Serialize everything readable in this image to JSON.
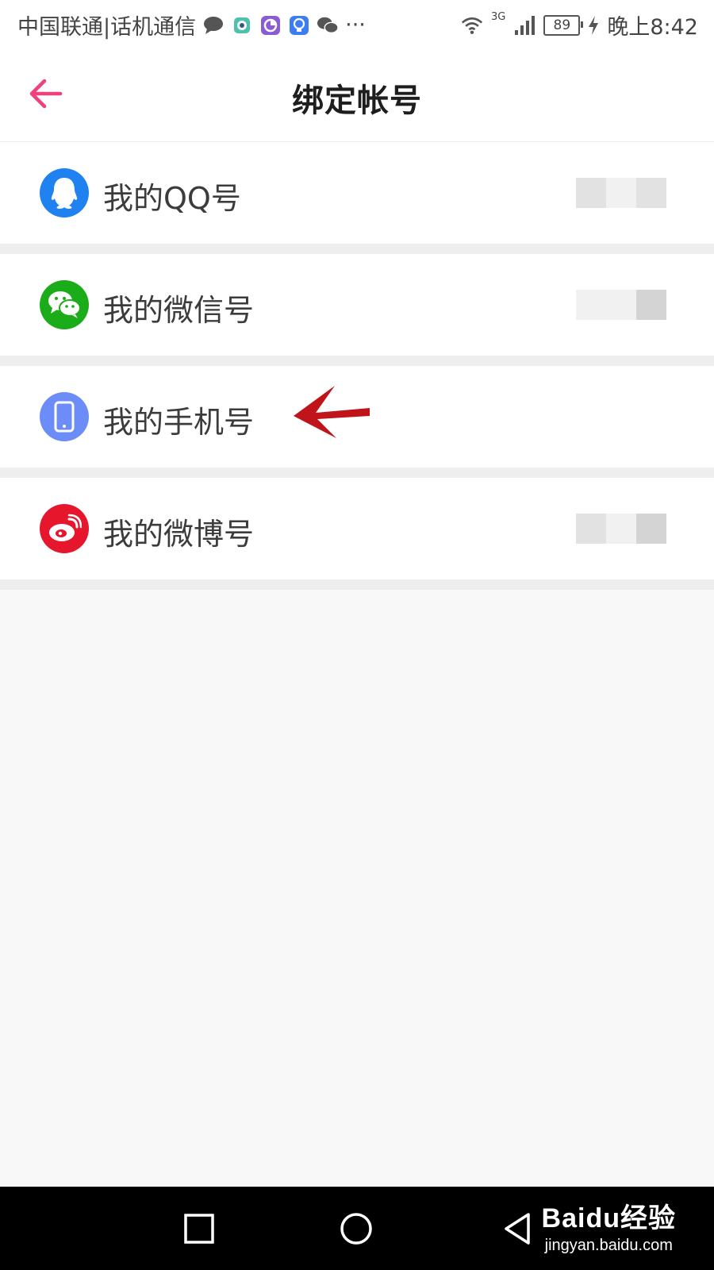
{
  "status_bar": {
    "carrier": "中国联通|话机通信",
    "network": "3G",
    "battery": "89",
    "time": "晚上8:42",
    "more": "···",
    "icons": [
      "chat-bubble-icon",
      "camera-app-icon",
      "chart-app-icon",
      "lightbulb-app-icon",
      "wechat-icon",
      "wifi-icon",
      "signal-icon",
      "charging-icon"
    ]
  },
  "header": {
    "title": "绑定帐号",
    "back_icon": "back-arrow-icon"
  },
  "accounts": [
    {
      "label": "我的QQ号",
      "icon": "qq-icon",
      "color": "#1f82f0"
    },
    {
      "label": "我的微信号",
      "icon": "wechat-icon",
      "color": "#1aad19"
    },
    {
      "label": "我的手机号",
      "icon": "phone-icon",
      "color": "#6c8cf8"
    },
    {
      "label": "我的微博号",
      "icon": "weibo-icon",
      "color": "#e6162d"
    }
  ],
  "annotation": {
    "color": "#c0141a",
    "icon": "red-arrow-icon"
  },
  "nav_bar": {
    "buttons": [
      "recent-apps-icon",
      "home-icon",
      "back-icon"
    ]
  },
  "watermark": {
    "brand": "Baidu经验",
    "url": "jingyan.baidu.com"
  },
  "colors": {
    "accent": "#f0427a",
    "background": "#f8f8f8",
    "divider": "#eeeeee"
  }
}
